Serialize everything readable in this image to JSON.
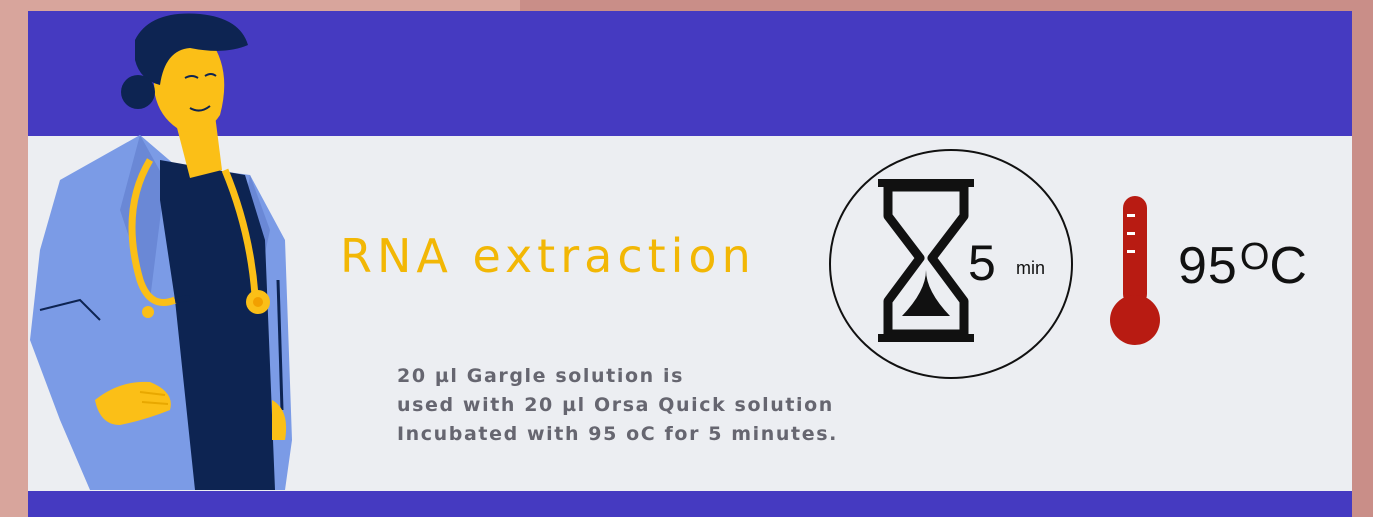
{
  "heading": "RNA extraction",
  "description": [
    "20  µl Gargle solution is",
    "used with 20 µl Orsa Quick solution",
    "Incubated with 95 oC for 5 minutes."
  ],
  "timer": {
    "value": "5",
    "unit": "min",
    "icon": "hourglass-icon"
  },
  "temperature": {
    "value": "95",
    "unit": "C",
    "degree_symbol": "O",
    "icon": "thermometer-icon"
  },
  "illustration": "doctor-with-stethoscope",
  "colors": {
    "banner": "#453ac1",
    "panel": "#eceef2",
    "heading": "#f2b705",
    "thermometer": "#b81b12",
    "doctor_coat": "#7b9be6",
    "doctor_shirt": "#0d2452",
    "skin": "#fbbf17"
  }
}
